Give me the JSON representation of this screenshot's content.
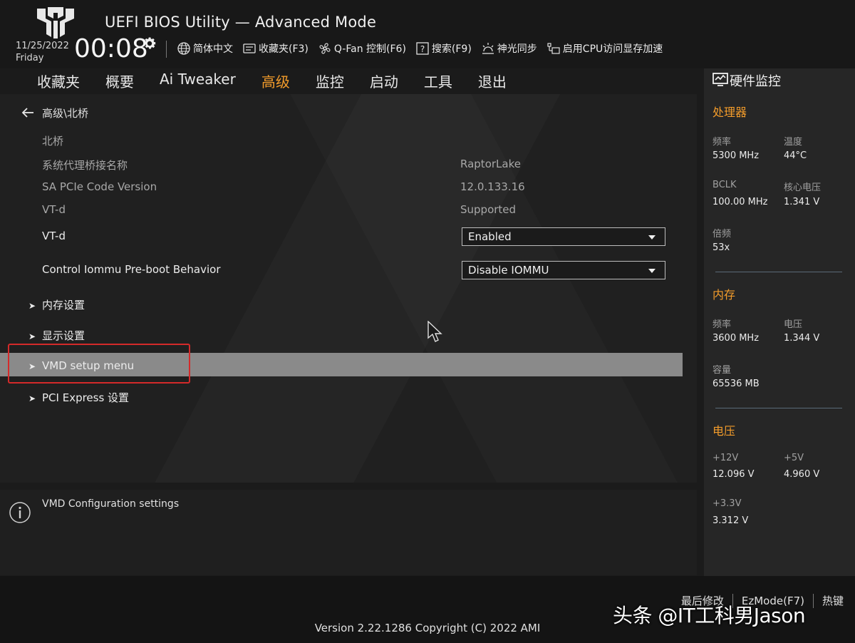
{
  "app": {
    "title": "UEFI BIOS Utility — Advanced Mode"
  },
  "header": {
    "date": "11/25/2022",
    "day": "Friday",
    "time": "00:08",
    "toolbar": [
      {
        "label": "简体中文",
        "icon": "globe-icon"
      },
      {
        "label": "收藏夹(F3)",
        "icon": "favorites-icon"
      },
      {
        "label": "Q-Fan 控制(F6)",
        "icon": "fan-icon"
      },
      {
        "label": "搜索(F9)",
        "icon": "search-help-icon"
      },
      {
        "label": "神光同步",
        "icon": "aura-sync-icon"
      },
      {
        "label": "启用CPU访问显存加速",
        "icon": "rebar-icon"
      }
    ]
  },
  "tabs": [
    "收藏夹",
    "概要",
    "Ai Tweaker",
    "高级",
    "监控",
    "启动",
    "工具",
    "退出"
  ],
  "active_tab": "高级",
  "main": {
    "breadcrumb": "高级\\北桥",
    "section_header": "北桥",
    "rows": [
      {
        "label": "系统代理桥接名称",
        "value": "RaptorLake"
      },
      {
        "label": "SA PCIe Code Version",
        "value": "12.0.133.16"
      },
      {
        "label": "VT-d",
        "value": "Supported"
      }
    ],
    "settings": [
      {
        "label": "VT-d",
        "value": "Enabled"
      },
      {
        "label": "Control Iommu Pre-boot Behavior",
        "value": "Disable IOMMU"
      }
    ],
    "submenus": [
      "内存设置",
      "显示设置",
      "VMD setup menu",
      "PCI Express 设置"
    ],
    "selected_submenu": "VMD setup menu"
  },
  "info": {
    "text": "VMD Configuration settings"
  },
  "hw": {
    "title": "硬件监控",
    "cpu": {
      "title": "处理器",
      "freq_label": "频率",
      "freq": "5300 MHz",
      "temp_label": "温度",
      "temp": "44°C",
      "bclk_label": "BCLK",
      "bclk": "100.00 MHz",
      "vcore_label": "核心电压",
      "vcore": "1.341 V",
      "ratio_label": "倍频",
      "ratio": "53x"
    },
    "memory": {
      "title": "内存",
      "freq_label": "频率",
      "freq": "3600 MHz",
      "volt_label": "电压",
      "volt": "1.344 V",
      "cap_label": "容量",
      "cap": "65536 MB"
    },
    "voltage": {
      "title": "电压",
      "v12_label": "+12V",
      "v12": "12.096 V",
      "v5_label": "+5V",
      "v5": "4.960 V",
      "v33_label": "+3.3V",
      "v33": "3.312 V"
    }
  },
  "footer": {
    "version": "Version 2.22.1286 Copyright (C) 2022 AMI",
    "keys": [
      "最后修改",
      "EzMode(F7)",
      "热键"
    ],
    "watermark": "头条 @IT工科男Jason"
  },
  "colors": {
    "accent": "#f39c2b",
    "highlight": "#8a8a8a",
    "annotation": "#d42a2a"
  }
}
